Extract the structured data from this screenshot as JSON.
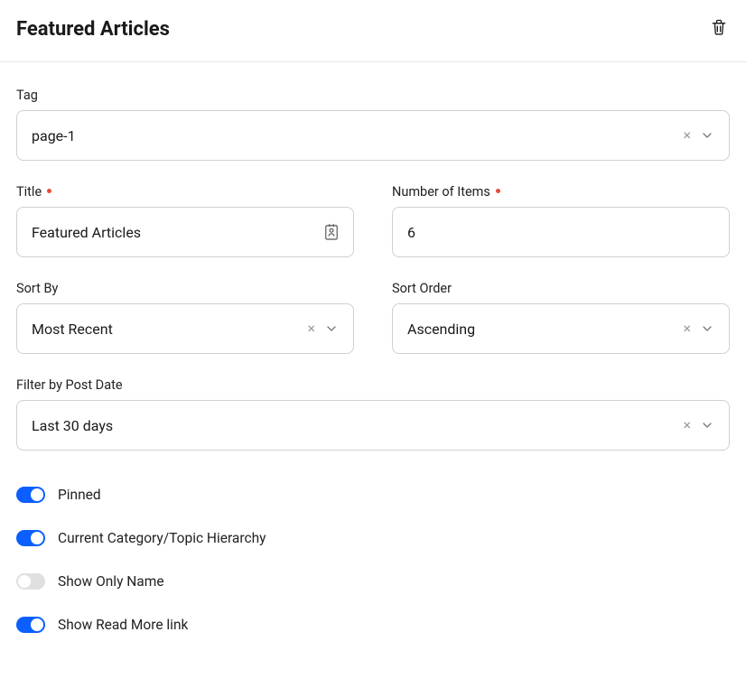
{
  "header": {
    "title": "Featured Articles"
  },
  "fields": {
    "tag": {
      "label": "Tag",
      "value": "page-1"
    },
    "title": {
      "label": "Title",
      "value": "Featured Articles"
    },
    "number_of_items": {
      "label": "Number of Items",
      "value": "6"
    },
    "sort_by": {
      "label": "Sort By",
      "value": "Most Recent"
    },
    "sort_order": {
      "label": "Sort Order",
      "value": "Ascending"
    },
    "filter_by_post_date": {
      "label": "Filter by Post Date",
      "value": "Last 30 days"
    }
  },
  "toggles": {
    "pinned": {
      "label": "Pinned",
      "on": true
    },
    "hierarchy": {
      "label": "Current Category/Topic Hierarchy",
      "on": true
    },
    "show_only_name": {
      "label": "Show Only Name",
      "on": false
    },
    "read_more": {
      "label": "Show Read More link",
      "on": true
    }
  }
}
